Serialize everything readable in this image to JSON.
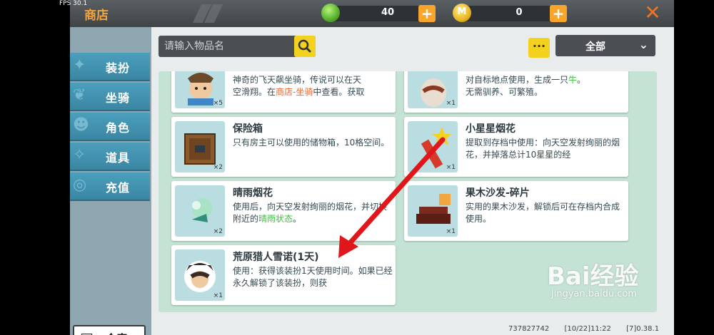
{
  "fps": "FPS 30.1",
  "title": "商店",
  "currency": {
    "gem_value": "40",
    "coin_value": "0",
    "coin_glyph": "M"
  },
  "sidebar": {
    "items": [
      {
        "label": "装扮",
        "icon": "outfit-icon"
      },
      {
        "label": "坐骑",
        "icon": "mount-icon"
      },
      {
        "label": "角色",
        "icon": "character-icon"
      },
      {
        "label": "道具",
        "icon": "item-icon"
      },
      {
        "label": "充值",
        "icon": "recharge-icon"
      }
    ],
    "warehouse_label": "仓库"
  },
  "search": {
    "placeholder": "请输入物品名"
  },
  "more_label": "···",
  "filter": {
    "selected": "全部"
  },
  "cards": {
    "mount_top": {
      "title": "",
      "line1": "神奇的飞天飙坐骑，传说可以在天",
      "line2a": "空滑翔。在",
      "line2b": "商店-坐骑",
      "line2c": "中查看。获取",
      "qty": "×5"
    },
    "firework_top": {
      "line1a": "对自标地点使用，生成一只",
      "line1b": "牛",
      "line1c": "。",
      "line2": "无需驯养、可繁殖。",
      "qty": "×1"
    },
    "safe": {
      "title": "保险箱",
      "desc": "只有房主可以使用的储物箱，10格空间。",
      "qty": "×2"
    },
    "star_firework": {
      "title": "小星星烟花",
      "desc": "提取到存档中使用：向天空发射绚丽的烟花，并掉落总计10星星的经",
      "qty": "×1"
    },
    "rain_firework": {
      "title": "晴雨烟花",
      "desc_a": "使用后，向天空发射绚丽的烟花，并切换附近的",
      "desc_b": "晴雨状态",
      "desc_c": "。",
      "qty": "×2"
    },
    "sofa": {
      "title": "果木沙发-碎片",
      "desc": "实用的果木沙发，解锁后可在存档内合成使用。",
      "qty": "×1"
    },
    "outfit": {
      "title": "荒原猎人雪诺(1天)",
      "desc": "使用：获得该装扮1天使用时间。如果已经永久解锁了该装扮，则获",
      "qty": "×1"
    }
  },
  "footer": {
    "id": "737827742",
    "time": "[10/22]11:22",
    "version": "[7]0.38.1"
  },
  "watermark": {
    "main": "Bai经验",
    "sub": "jingyan.baidu.com"
  },
  "colors": {
    "title_orange": "#f3a640",
    "sidebar_blue": "#4b9fbd",
    "grid_green": "#c4e3d4",
    "button_yellow": "#f3d21f",
    "arrow_red": "#e0161a"
  }
}
